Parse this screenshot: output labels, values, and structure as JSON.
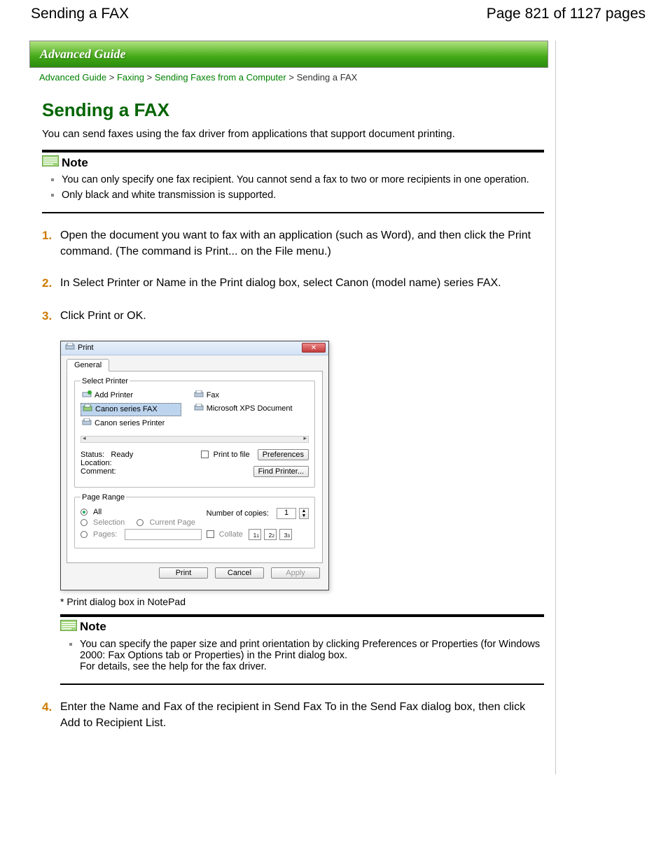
{
  "header": {
    "left_title": "Sending a FAX",
    "page_indicator": "Page 821 of 1127 pages"
  },
  "banner": "Advanced Guide",
  "breadcrumb": {
    "link1": "Advanced Guide",
    "link2": "Faxing",
    "link3": "Sending Faxes from a Computer",
    "current": "Sending a FAX",
    "sep": ">"
  },
  "title": "Sending a FAX",
  "intro": "You can send faxes using the fax driver from applications that support document printing.",
  "note1": {
    "heading": "Note",
    "items": [
      "You can only specify one fax recipient. You cannot send a fax to two or more recipients in one operation.",
      "Only black and white transmission is supported."
    ]
  },
  "steps": [
    "Open the document you want to fax with an application (such as Word), and then click the Print command. (The command is Print... on the File menu.)",
    "In Select Printer or Name in the Print dialog box, select Canon (model name) series FAX.",
    "Click Print or OK.",
    "Enter the Name and Fax of the recipient in Send Fax To in the Send Fax dialog box, then click Add to Recipient List."
  ],
  "print_dialog": {
    "title": "Print",
    "tab": "General",
    "select_printer_legend": "Select Printer",
    "printers": {
      "add": "Add Printer",
      "canon_fax": "Canon          series FAX",
      "canon_printer": "Canon          series Printer",
      "fax": "Fax",
      "ms_xps": "Microsoft XPS Document"
    },
    "status_label": "Status:",
    "status_value": "Ready",
    "location_label": "Location:",
    "comment_label": "Comment:",
    "print_to_file": "Print to file",
    "preferences_btn": "Preferences",
    "find_printer_btn": "Find Printer...",
    "page_range_legend": "Page Range",
    "all_label": "All",
    "selection_label": "Selection",
    "current_page_label": "Current Page",
    "pages_label": "Pages:",
    "copies_label": "Number of copies:",
    "copies_value": "1",
    "collate_label": "Collate",
    "print_btn": "Print",
    "cancel_btn": "Cancel",
    "apply_btn": "Apply"
  },
  "dialog_caption": "*  Print dialog box in NotePad",
  "note2": {
    "heading": "Note",
    "items": [
      "You can specify the paper size and print orientation by clicking Preferences or Properties (for Windows 2000: Fax Options tab or Properties) in the Print dialog box.\nFor details, see the help for the fax driver."
    ]
  }
}
